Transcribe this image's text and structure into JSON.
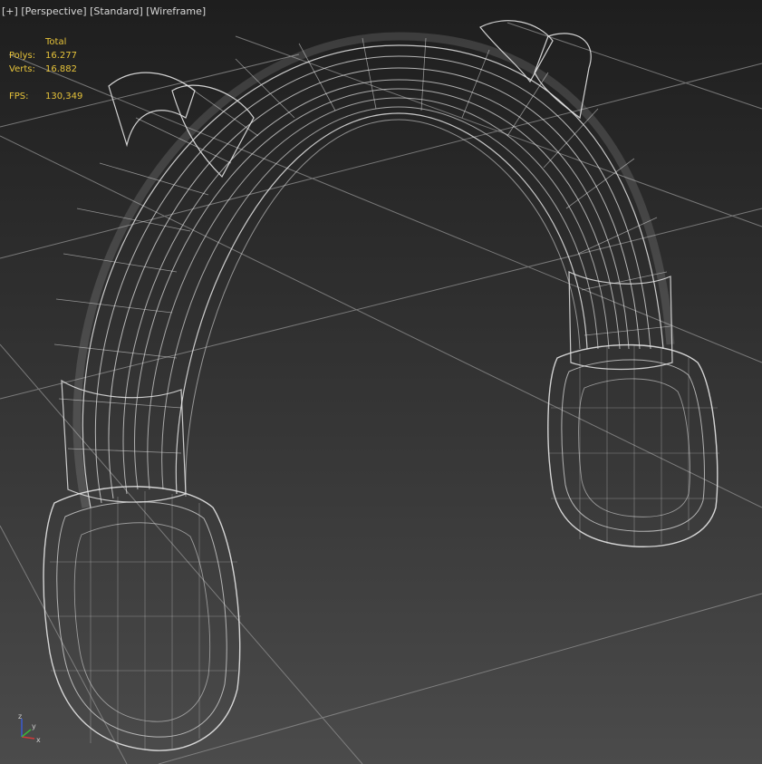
{
  "viewport": {
    "label_plus": "[+]",
    "label_view": "[Perspective]",
    "label_shading": "[Standard]",
    "label_mode": "[Wireframe]"
  },
  "stats": {
    "header": "Total",
    "polys_label": "Polys:",
    "polys_value": "16.277",
    "verts_label": "Verts:",
    "verts_value": "16.882",
    "fps_label": "FPS:",
    "fps_value": "130,349"
  },
  "axis_gizmo": {
    "x_label": "x",
    "y_label": "y",
    "z_label": "z"
  },
  "colors": {
    "wire": "#e6e6e6",
    "grid": "#8a8a8a",
    "stats_text": "#e6c33a",
    "axis_x": "#d13a3a",
    "axis_y": "#3ab53a",
    "axis_z": "#3a5ad1"
  },
  "object": {
    "name": "headphones-wireframe-mesh"
  }
}
